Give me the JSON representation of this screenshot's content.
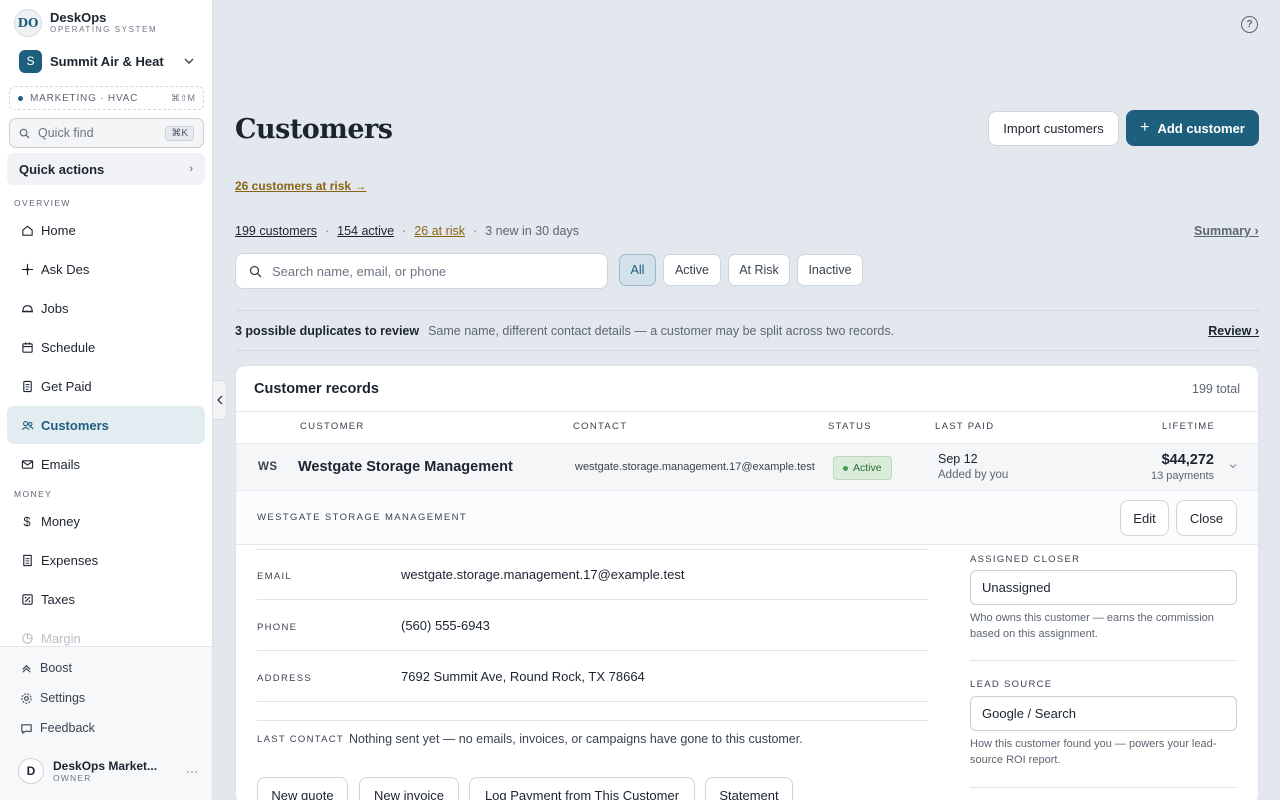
{
  "brand": {
    "logo_text": "DO",
    "name": "DeskOps",
    "subtitle": "OPERATING SYSTEM"
  },
  "org": {
    "avatar": "S",
    "name": "Summit Air & Heat"
  },
  "workspace": {
    "label": "MARKETING · HVAC",
    "shortcut": "⌘⇧M"
  },
  "quickfind": {
    "placeholder": "Quick find",
    "shortcut": "⌘K"
  },
  "quick_actions": {
    "label": "Quick actions",
    "chevron": "›"
  },
  "nav": {
    "overview_label": "OVERVIEW",
    "money_label": "MONEY",
    "items": [
      {
        "label": "Home",
        "icon": "home-icon"
      },
      {
        "label": "Ask Des",
        "icon": "sparkle-icon"
      },
      {
        "label": "Jobs",
        "icon": "hardhat-icon"
      },
      {
        "label": "Schedule",
        "icon": "calendar-icon"
      },
      {
        "label": "Get Paid",
        "icon": "invoice-icon"
      },
      {
        "label": "Customers",
        "icon": "users-icon",
        "active": true
      },
      {
        "label": "Emails",
        "icon": "mail-icon"
      },
      {
        "label": "Money",
        "icon": "dollar-icon"
      },
      {
        "label": "Expenses",
        "icon": "receipt-icon"
      },
      {
        "label": "Taxes",
        "icon": "tax-icon"
      },
      {
        "label": "Margin",
        "icon": "chart-icon"
      }
    ]
  },
  "footer": {
    "boost": "Boost",
    "settings": "Settings",
    "feedback": "Feedback",
    "user_initial": "D",
    "user_name": "DeskOps Market...",
    "user_role": "OWNER",
    "more": "···"
  },
  "help": "?",
  "page": {
    "title": "Customers",
    "import_label": "Import customers",
    "add_label": "Add customer",
    "risk_link": "26 customers at risk →"
  },
  "stats": {
    "total": "199 customers",
    "active": "154 active",
    "at_risk": "26 at risk",
    "new": "3 new in 30 days",
    "sep": "·",
    "summary": "Summary ›"
  },
  "search": {
    "placeholder": "Search name, email, or phone"
  },
  "filters": [
    "All",
    "Active",
    "At Risk",
    "Inactive"
  ],
  "duplicates": {
    "title": "3 possible duplicates to review",
    "desc": "Same name, different contact details — a customer may be split across two records.",
    "review": "Review ›"
  },
  "records": {
    "title": "Customer records",
    "count": "199 total",
    "columns": {
      "customer": "CUSTOMER",
      "contact": "CONTACT",
      "status": "STATUS",
      "last_paid": "LAST PAID",
      "lifetime": "LIFETIME"
    },
    "row": {
      "initials": "WS",
      "name": "Westgate Storage Management",
      "email": "westgate.storage.management.17@example.test",
      "status": "Active",
      "last_paid": "Sep 12",
      "added_by": "Added by you",
      "lifetime": "$44,272",
      "payments": "13 payments"
    }
  },
  "detail": {
    "title": "WESTGATE STORAGE MANAGEMENT",
    "edit": "Edit",
    "close": "Close",
    "fields": [
      {
        "label": "EMAIL",
        "value": "westgate.storage.management.17@example.test"
      },
      {
        "label": "PHONE",
        "value": "(560) 555-6943"
      },
      {
        "label": "ADDRESS",
        "value": "7692 Summit Ave, Round Rock, TX 78664"
      }
    ],
    "last_contact_label": "LAST CONTACT",
    "last_contact_text": "Nothing sent yet — no emails, invoices, or campaigns have gone to this customer.",
    "actions": [
      "New quote",
      "New invoice",
      "Log Payment from This Customer",
      "Statement"
    ],
    "closer_label": "ASSIGNED CLOSER",
    "closer_value": "Unassigned",
    "closer_help": "Who owns this customer — earns the commission based on this assignment.",
    "lead_label": "LEAD SOURCE",
    "lead_value": "Google / Search",
    "lead_help": "How this customer found you — powers your lead-source ROI report."
  },
  "colors": {
    "accent": "#1e5f7d",
    "risk": "#8a6415",
    "active_green": "#4a9a52"
  }
}
